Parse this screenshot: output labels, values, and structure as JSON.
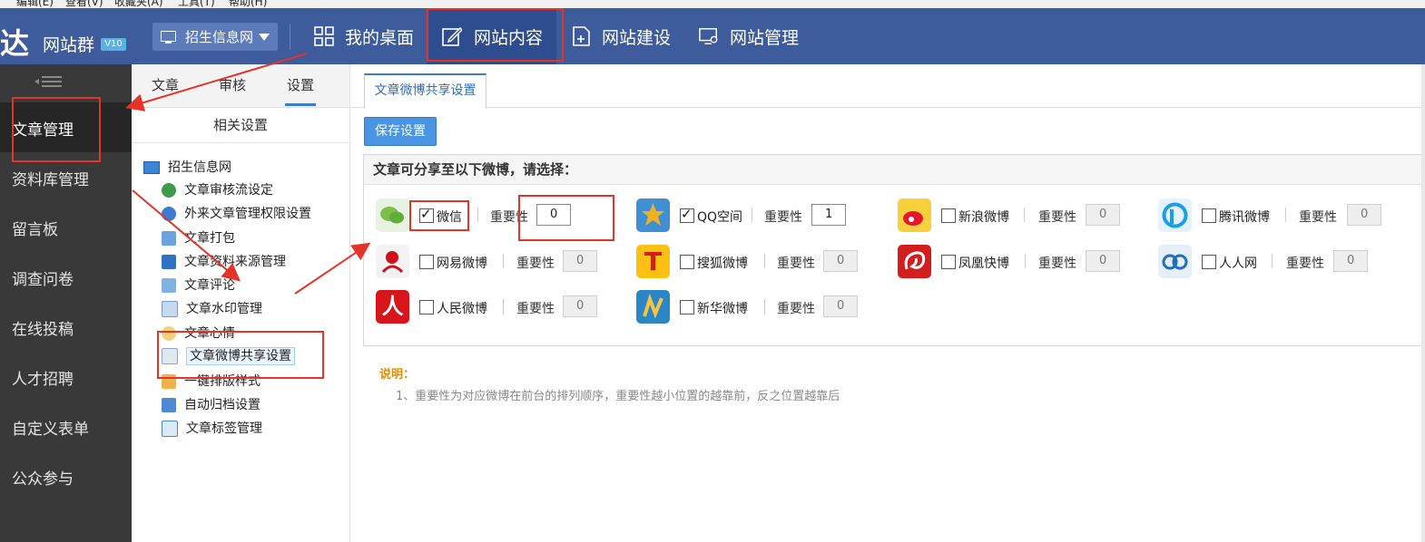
{
  "browser_menu": [
    "编辑(E)",
    "查看(V)",
    "收藏夹(A)",
    "工具(T)",
    "帮助(H)"
  ],
  "logo": {
    "mark": "达",
    "text": "网站群",
    "version": "V10"
  },
  "site_selector": {
    "value": "招生信息网"
  },
  "top_nav": [
    {
      "label": "我的桌面",
      "icon": "grid-icon"
    },
    {
      "label": "网站内容",
      "icon": "edit-icon"
    },
    {
      "label": "网站建设",
      "icon": "add-page-icon"
    },
    {
      "label": "网站管理",
      "icon": "monitor-gear-icon"
    }
  ],
  "sidebar": {
    "items": [
      "文章管理",
      "资料库管理",
      "留言板",
      "调查问卷",
      "在线投稿",
      "人才招聘",
      "自定义表单",
      "公众参与"
    ],
    "active": "文章管理"
  },
  "panel": {
    "tabs": [
      "文章",
      "审核",
      "设置"
    ],
    "active_tab": "设置",
    "subtitle": "相关设置",
    "tree_root": "招生信息网",
    "tree_items": [
      "文章审核流设定",
      "外来文章管理权限设置",
      "文章打包",
      "文章资料来源管理",
      "文章评论",
      "文章水印管理",
      "文章心情",
      "文章微博共享设置",
      "一键排版样式",
      "自动归档设置",
      "文章标签管理"
    ],
    "selected_item": "文章微博共享设置"
  },
  "content": {
    "tab": "文章微博共享设置",
    "save_button": "保存设置",
    "section_title": "文章可分享至以下微博，请选择：",
    "importance_label": "重要性",
    "platforms": [
      {
        "name": "微信",
        "checked": true,
        "importance": "0",
        "icon": "wechat-icon",
        "color": "#7cc04b"
      },
      {
        "name": "QQ空间",
        "checked": true,
        "importance": "1",
        "icon": "qzone-icon",
        "color": "#f2b01e"
      },
      {
        "name": "新浪微博",
        "checked": false,
        "importance": "0",
        "icon": "sina-weibo-icon",
        "color": "#e6162d"
      },
      {
        "name": "腾讯微博",
        "checked": false,
        "importance": "0",
        "icon": "tencent-weibo-icon",
        "color": "#1a9ee6"
      },
      {
        "name": "网易微博",
        "checked": false,
        "importance": "0",
        "icon": "netease-weibo-icon",
        "color": "#d0111b"
      },
      {
        "name": "搜狐微博",
        "checked": false,
        "importance": "0",
        "icon": "sohu-weibo-icon",
        "color": "#fcc112"
      },
      {
        "name": "凤凰快博",
        "checked": false,
        "importance": "0",
        "icon": "ifeng-icon",
        "color": "#d41d1d"
      },
      {
        "name": "人人网",
        "checked": false,
        "importance": "0",
        "icon": "renren-icon",
        "color": "#1f6fbd"
      },
      {
        "name": "人民微博",
        "checked": false,
        "importance": "0",
        "icon": "people-weibo-icon",
        "color": "#d8151b"
      },
      {
        "name": "新华微博",
        "checked": false,
        "importance": "0",
        "icon": "xinhua-weibo-icon",
        "color": "#2a86c4"
      }
    ],
    "note_title": "说明：",
    "note_1": "1、重要性为对应微博在前台的排列顺序，重要性越小位置的越靠前，反之位置越靠后"
  },
  "colors": {
    "topbar": "#3e5c9b",
    "sidebar": "#393939",
    "accent": "#3b7bd1",
    "annotation": "#e5332a"
  }
}
